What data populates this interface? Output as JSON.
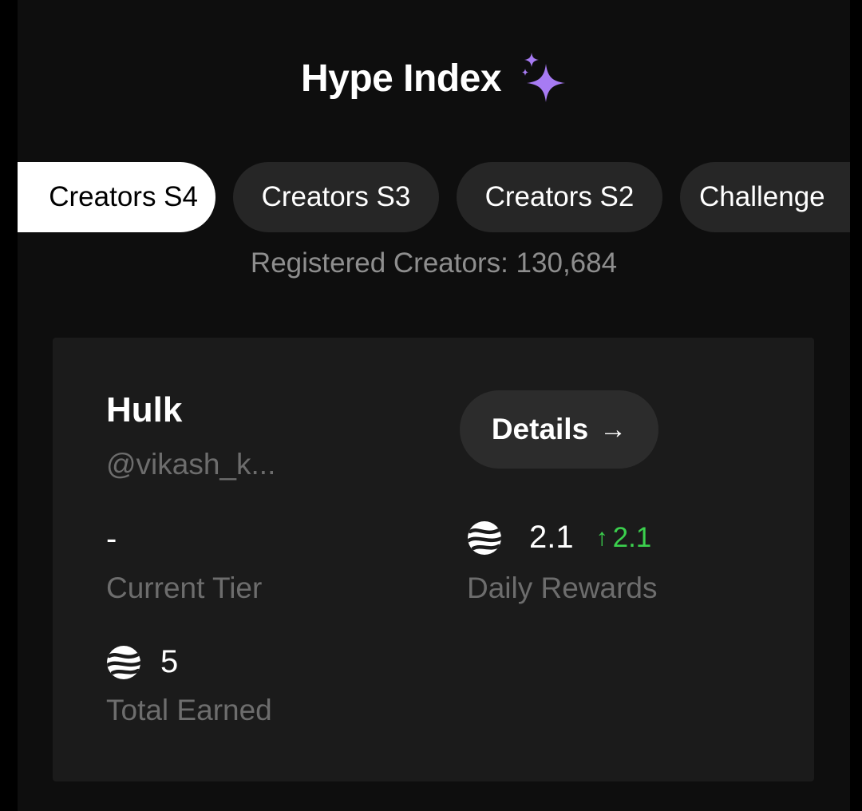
{
  "header": {
    "title": "Hype Index",
    "title_icon": "sparkles-icon",
    "accent": "#a77bf3"
  },
  "tabs": [
    {
      "label": "Creators S4",
      "active": true
    },
    {
      "label": "Creators S3",
      "active": false
    },
    {
      "label": "Creators S2",
      "active": false
    },
    {
      "label": "Challenge",
      "active": false
    }
  ],
  "registered": "Registered Creators: 130,684",
  "card": {
    "name": "Hulk",
    "handle": "@vikash_k...",
    "details_label": "Details",
    "details_arrow": "→",
    "current_tier_value": "-",
    "current_tier_label": "Current Tier",
    "daily_rewards_value": "2.1",
    "daily_rewards_change": "2.1",
    "daily_rewards_change_icon": "↑",
    "daily_rewards_label": "Daily Rewards",
    "total_earned_value": "5",
    "total_earned_label": "Total Earned",
    "token_icon": "token-coin-icon",
    "positive_color": "#3bd04d"
  }
}
